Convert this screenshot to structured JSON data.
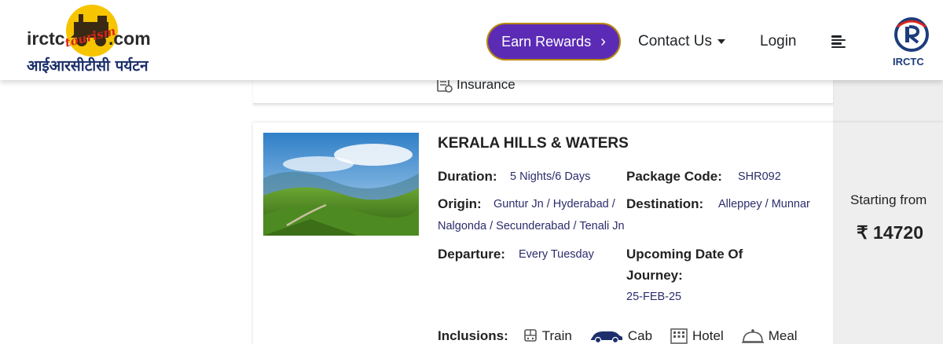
{
  "header": {
    "logo": {
      "left_word": "irctc",
      "tourism_word": "tourism",
      "right_word": ".com",
      "hindi": "आईआरसीटीसी पर्यटन"
    },
    "earn_rewards_label": "Earn Rewards",
    "contact_label": "Contact Us",
    "login_label": "Login",
    "irctc_logo_text": "IRCTC"
  },
  "previous_card": {
    "inclusion_label": "Insurance"
  },
  "package": {
    "title": "KERALA HILLS & WATERS",
    "duration_label": "Duration:",
    "duration_value": "5 Nights/6 Days",
    "code_label": "Package Code:",
    "code_value": "SHR092",
    "origin_label": "Origin:",
    "origin_value_line1": "Guntur Jn / Hyderabad /",
    "origin_value_line2": "Nalgonda / Secunderabad / Tenali Jn",
    "destination_label": "Destination:",
    "destination_value": "Alleppey / Munnar",
    "departure_label": "Departure:",
    "departure_value": "Every Tuesday",
    "upcoming_label_line1": "Upcoming Date Of",
    "upcoming_label_line2": "Journey:",
    "upcoming_value": "25-FEB-25",
    "starting_from": "Starting from",
    "price": "₹ 14720",
    "inclusions_label": "Inclusions:",
    "inclusions": [
      {
        "icon": "train-icon",
        "label": "Train"
      },
      {
        "icon": "cab-icon",
        "label": "Cab"
      },
      {
        "icon": "hotel-icon",
        "label": "Hotel"
      },
      {
        "icon": "meal-icon",
        "label": "Meal"
      }
    ]
  },
  "colors": {
    "brand_purple": "#5b2bb5",
    "value_text": "#2c2c6c",
    "logo_yellow": "#f7c500",
    "irctc_blue": "#1c3c7c"
  }
}
